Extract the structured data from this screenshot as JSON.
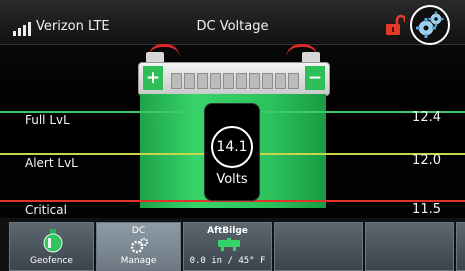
{
  "status": {
    "carrier": "Verizon LTE"
  },
  "header": {
    "title": "DC Voltage"
  },
  "icons": {
    "signal": "signal-bars-icon",
    "lock": "unlocked-padlock-icon",
    "settings": "settings-gear-icon",
    "battery": "battery-icon",
    "geofence": "geofence-buoy-icon",
    "dc_manage": "dc-manage-gears-icon",
    "bilge": "bilge-pump-icon"
  },
  "battery": {
    "plus_sign": "+",
    "minus_sign": "−"
  },
  "reading": {
    "value": "14.1",
    "unit": "Volts"
  },
  "levels": [
    {
      "label": "Full LvL",
      "value": "12.4",
      "color": "#3ec96a"
    },
    {
      "label": "Alert LvL",
      "value": "12.0",
      "color": "#c7d64a"
    },
    {
      "label": "Critical",
      "value": "11.5",
      "color": "#e0332c"
    }
  ],
  "tabs": [
    {
      "label": "Geofence"
    },
    {
      "top": "DC",
      "label": "Manage"
    },
    {
      "top": "AftBilge",
      "label": "0.0 in / 45° F"
    },
    {
      "label": ""
    },
    {
      "label": ""
    },
    {
      "label": ""
    }
  ],
  "colors": {
    "battery_green": "#2cc25c",
    "lock_red": "#e53a2a",
    "tab_active": "#7d8a94",
    "bilge_green": "#35d46a"
  }
}
